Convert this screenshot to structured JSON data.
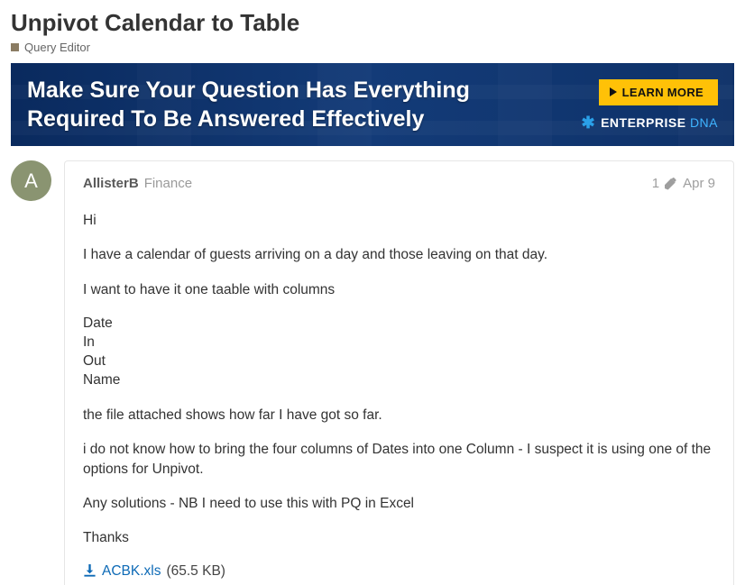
{
  "topic": {
    "title": "Unpivot Calendar to Table",
    "category": "Query Editor",
    "category_color": "#8b7c63"
  },
  "banner": {
    "line1": "Make Sure Your Question Has Everything",
    "line2": "Required To Be Answered Effectively",
    "cta": "LEARN MORE",
    "brand_a": "ENTERPRISE",
    "brand_b": "DNA"
  },
  "post": {
    "avatar_letter": "A",
    "author": "AllisterB",
    "author_title": "Finance",
    "edit_count": "1",
    "date": "Apr 9",
    "body": {
      "p1": "Hi",
      "p2": "I have a calendar of guests arriving on a day and those leaving on that day.",
      "p3": "I want to have it one taable with columns",
      "cols": {
        "c1": "Date",
        "c2": "In",
        "c3": "Out",
        "c4": "Name"
      },
      "p4": "the file attached shows how far I have got so far.",
      "p5": "i do not know how to bring the four columns of Dates into one Column - I suspect it is using one of the options for Unpivot.",
      "p6": "Any solutions - NB I need to use this with PQ in Excel",
      "p7": "Thanks"
    },
    "attachment": {
      "name": "ACBK.xls",
      "size": "(65.5 KB)"
    }
  }
}
